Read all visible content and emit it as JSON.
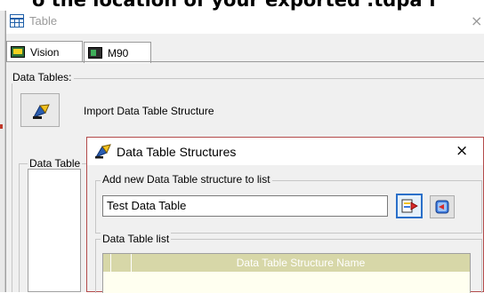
{
  "instruction_banner": "o the location of your exported .tdpa f",
  "window": {
    "title": "Table",
    "close_glyph": "×",
    "icon": "table-grid-icon"
  },
  "tabs": [
    {
      "label": "Vision",
      "icon": "vision-panel-icon",
      "active": true
    },
    {
      "label": "M90",
      "icon": "m90-panel-icon",
      "active": false
    }
  ],
  "groups": {
    "data_tables_label": "Data Tables:",
    "data_table_label": "Data Table"
  },
  "import": {
    "label": "Import Data Table Structure",
    "icon": "import-wand-icon"
  },
  "dialog": {
    "title": "Data Table Structures",
    "close_glyph": "×",
    "add_group_label": "Add new Data Table structure to list",
    "input_value": "Test Data Table",
    "add_button_icon": "add-structure-icon",
    "remove_button_icon": "remove-structure-icon",
    "list_group_label": "Data Table list",
    "list_columns": [
      "",
      "",
      "Data Table Structure Name"
    ]
  },
  "colors": {
    "accent": "#2a6fc9",
    "dialog_border": "#b34a4a",
    "grid_header": "#d7d7a8",
    "grid_background": "#fffff0"
  }
}
